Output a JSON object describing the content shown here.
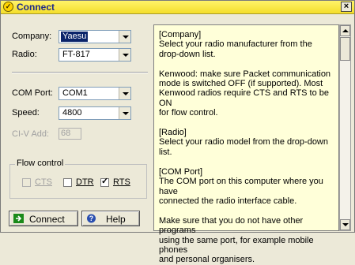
{
  "window": {
    "title": "Connect",
    "close_glyph": "×",
    "title_icon": "connect-icon"
  },
  "form": {
    "company": {
      "label": "Company:",
      "value": "Yaesu"
    },
    "radio": {
      "label": "Radio:",
      "value": "FT-817"
    },
    "com_port": {
      "label": "COM Port:",
      "value": "COM1"
    },
    "speed": {
      "label": "Speed:",
      "value": "4800"
    },
    "civ": {
      "label": "CI-V Add:",
      "value": "68"
    },
    "flow_control": {
      "title": "Flow control",
      "cts": {
        "label": "CTS",
        "checked": false,
        "enabled": false
      },
      "dtr": {
        "label": "DTR",
        "checked": false,
        "enabled": true
      },
      "rts": {
        "label": "RTS",
        "checked": true,
        "enabled": true
      }
    }
  },
  "buttons": {
    "connect_label": "Connect",
    "help_label": "Help"
  },
  "help": {
    "text": "[Company]\nSelect your radio manufacturer from the\ndrop-down list.\n\nKenwood: make sure Packet communication\nmode is switched OFF (if supported). Most\nKenwood radios require CTS and RTS to be ON\nfor flow control.\n\n[Radio]\nSelect your radio model from the drop-down list.\n\n[COM Port]\nThe COM port on this computer where you have\nconnected the radio interface cable.\n\nMake sure that you do not have other programs\nusing the same port, for example mobile phones\nand personal organisers."
  },
  "colors": {
    "titlebar": "#f4de2a",
    "selection": "#0a246a",
    "help_bg": "#ffffd9",
    "connect_icon": "#1a8a1a",
    "help_icon": "#2a4fb0"
  }
}
